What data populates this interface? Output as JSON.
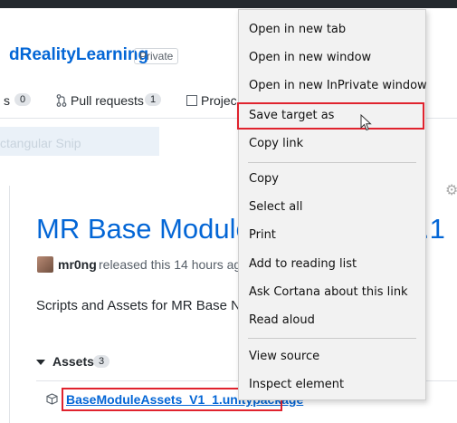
{
  "header": {
    "repo_title": "dRealityLearning",
    "private_badge": "Private"
  },
  "tabs": {
    "issues_suffix": "s",
    "issues_count": "0",
    "pull_requests_label": "Pull requests",
    "pull_requests_count": "1",
    "projects_label": "Projec"
  },
  "snip": {
    "text": "ctangular Snip"
  },
  "release": {
    "title": "MR Base Module",
    "title_suffix": ".1",
    "author": "mr0ng",
    "released_text": "released this 14 hours ago",
    "description": "Scripts and Assets for MR Base N",
    "assets_label": "Assets",
    "assets_count": "3",
    "asset_file": "BaseModuleAssets_V1_1.unitypackage"
  },
  "context_menu": {
    "items": [
      "Open in new tab",
      "Open in new window",
      "Open in new InPrivate window",
      "Save target as",
      "Copy link",
      "Copy",
      "Select all",
      "Print",
      "Add to reading list",
      "Ask Cortana about this link",
      "Read aloud",
      "View source",
      "Inspect element"
    ]
  },
  "colors": {
    "link_blue": "#0366d6",
    "highlight_red": "#e0232e",
    "menu_bg": "#f2f2f2"
  }
}
